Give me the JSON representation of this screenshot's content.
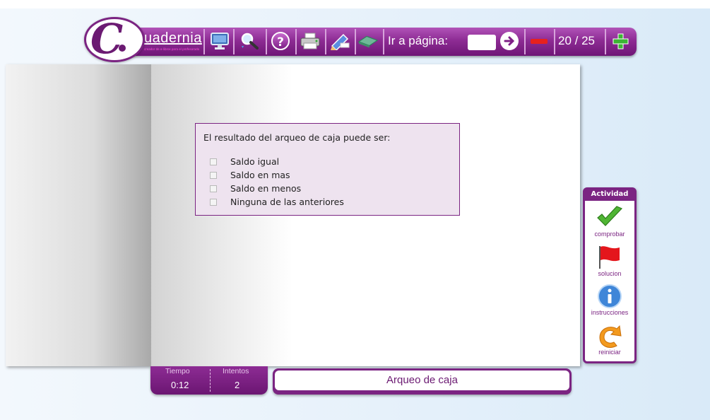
{
  "brand": {
    "name": "uadernia",
    "tagline": "creador de e-libros para el profesorado"
  },
  "toolbar": {
    "goto_label": "Ir a página:",
    "goto_value": "",
    "page_counter": "20 / 25",
    "help_glyph": "?",
    "icons": [
      "monitor-icon",
      "search-icon",
      "help-icon",
      "printer-icon",
      "pencil-icon",
      "eraser-icon",
      "go-arrow-icon",
      "minus-icon",
      "plus-icon"
    ]
  },
  "quiz": {
    "question": "El resultado del arqueo de caja puede ser:",
    "options": [
      "Saldo igual",
      "Saldo en mas",
      "Saldo en menos",
      "Ninguna de las anteriores"
    ]
  },
  "activity": {
    "title": "Actividad",
    "items": [
      {
        "label": "comprobar",
        "icon": "check-icon"
      },
      {
        "label": "solucion",
        "icon": "flag-icon"
      },
      {
        "label": "instrucciones",
        "icon": "info-icon"
      },
      {
        "label": "reiniciar",
        "icon": "reset-arrow-icon"
      }
    ]
  },
  "stats": {
    "time_label": "Tiempo",
    "time_value": "0:12",
    "attempts_label": "Intentos",
    "attempts_value": "2"
  },
  "footer": {
    "title": "Arqueo de caja"
  },
  "colors": {
    "brand_purple": "#7b2482",
    "minus_red": "#e7211e",
    "plus_green": "#3cb534"
  }
}
